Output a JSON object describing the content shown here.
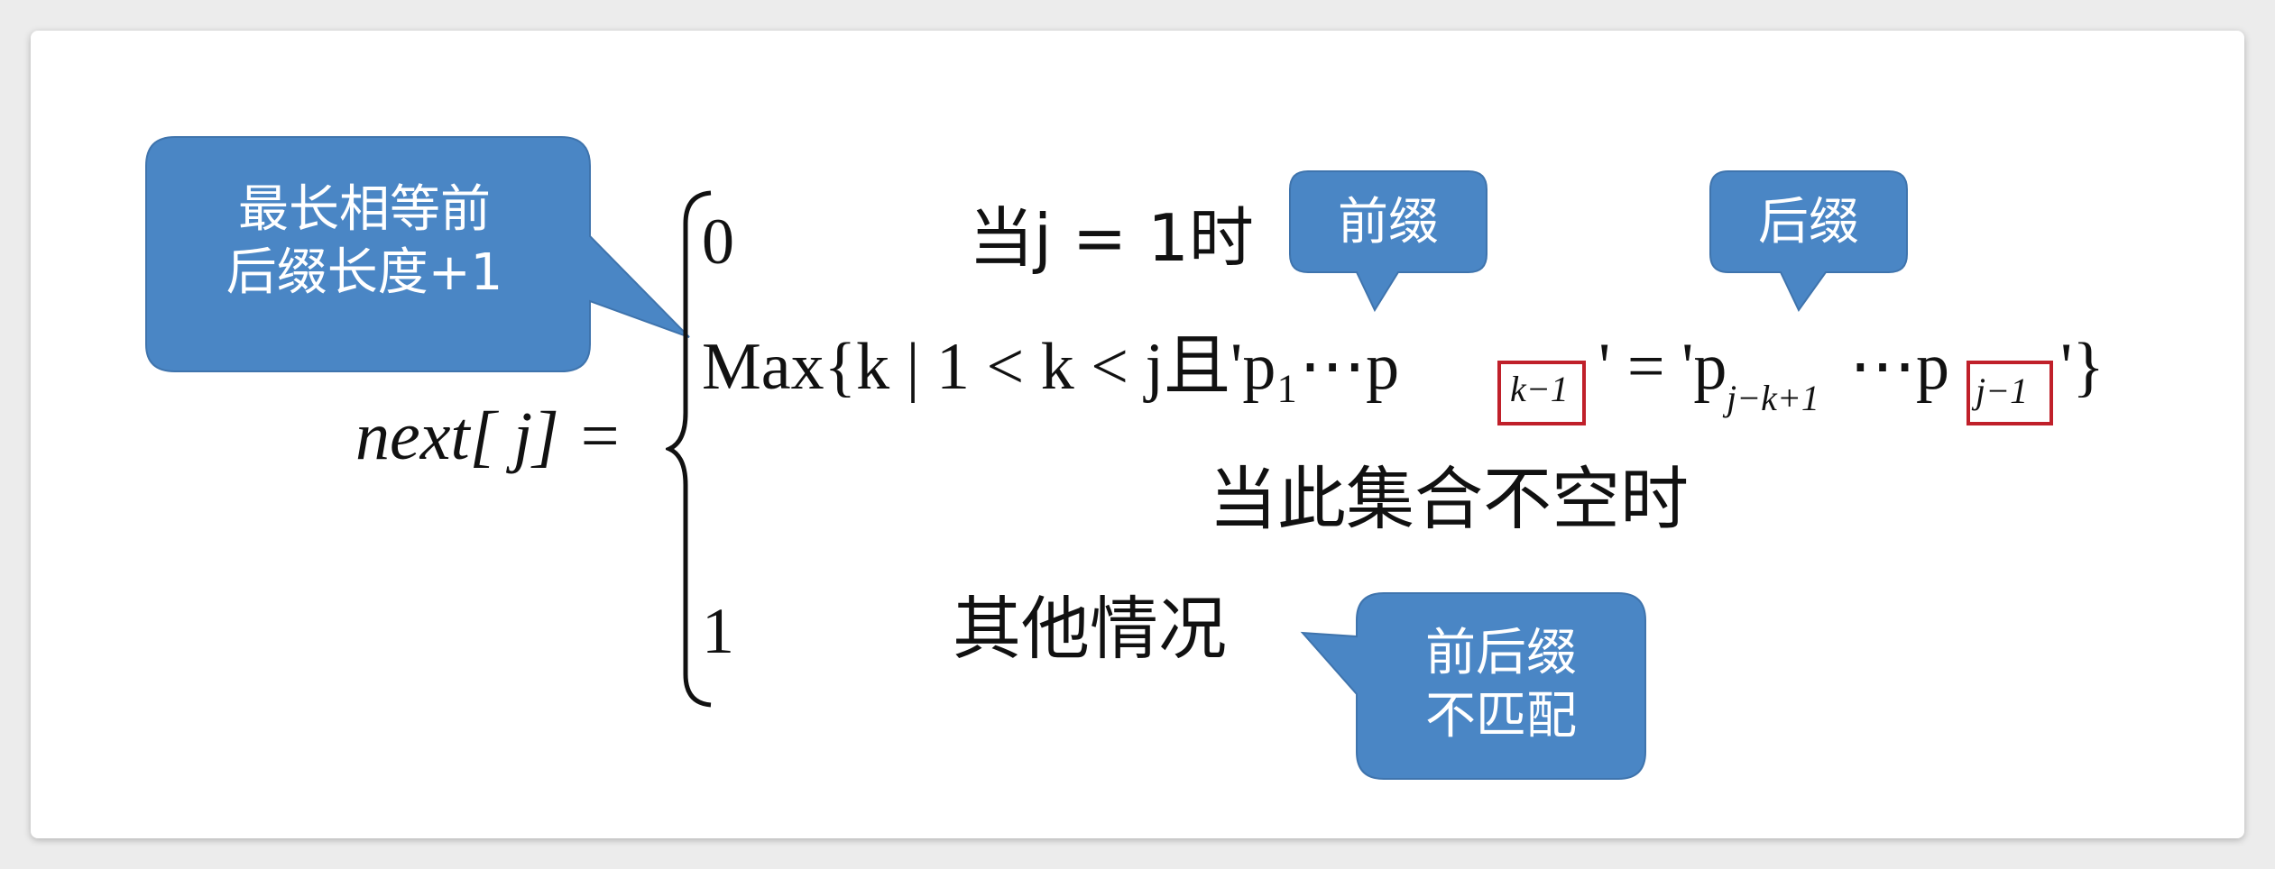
{
  "formula": {
    "lhs": "next[ j] =",
    "case0_value": "0",
    "case0_cond": "当j = 1时",
    "case_max_expr": "Max{k | 1 < k < j且'p₁⋯p",
    "case_max_sub1": "k−1",
    "case_max_mid": "' = 'p",
    "case_max_sub2": "j−k+1",
    "case_max_dots": "⋯p",
    "case_max_sub3": "j−1",
    "case_max_end": "'}",
    "case_max_cond": "当此集合不空时",
    "case1_value": "1",
    "case1_cond": "其他情况"
  },
  "callouts": {
    "longest_line1": "最长相等前",
    "longest_line2": "后缀长度+1",
    "prefix": "前缀",
    "suffix": "后缀",
    "nomatch_line1": "前后缀",
    "nomatch_line2": "不匹配"
  },
  "colors": {
    "callout_fill": "#4a86c5",
    "callout_stroke": "#3f74ad",
    "highlight_box": "#c0202a"
  }
}
